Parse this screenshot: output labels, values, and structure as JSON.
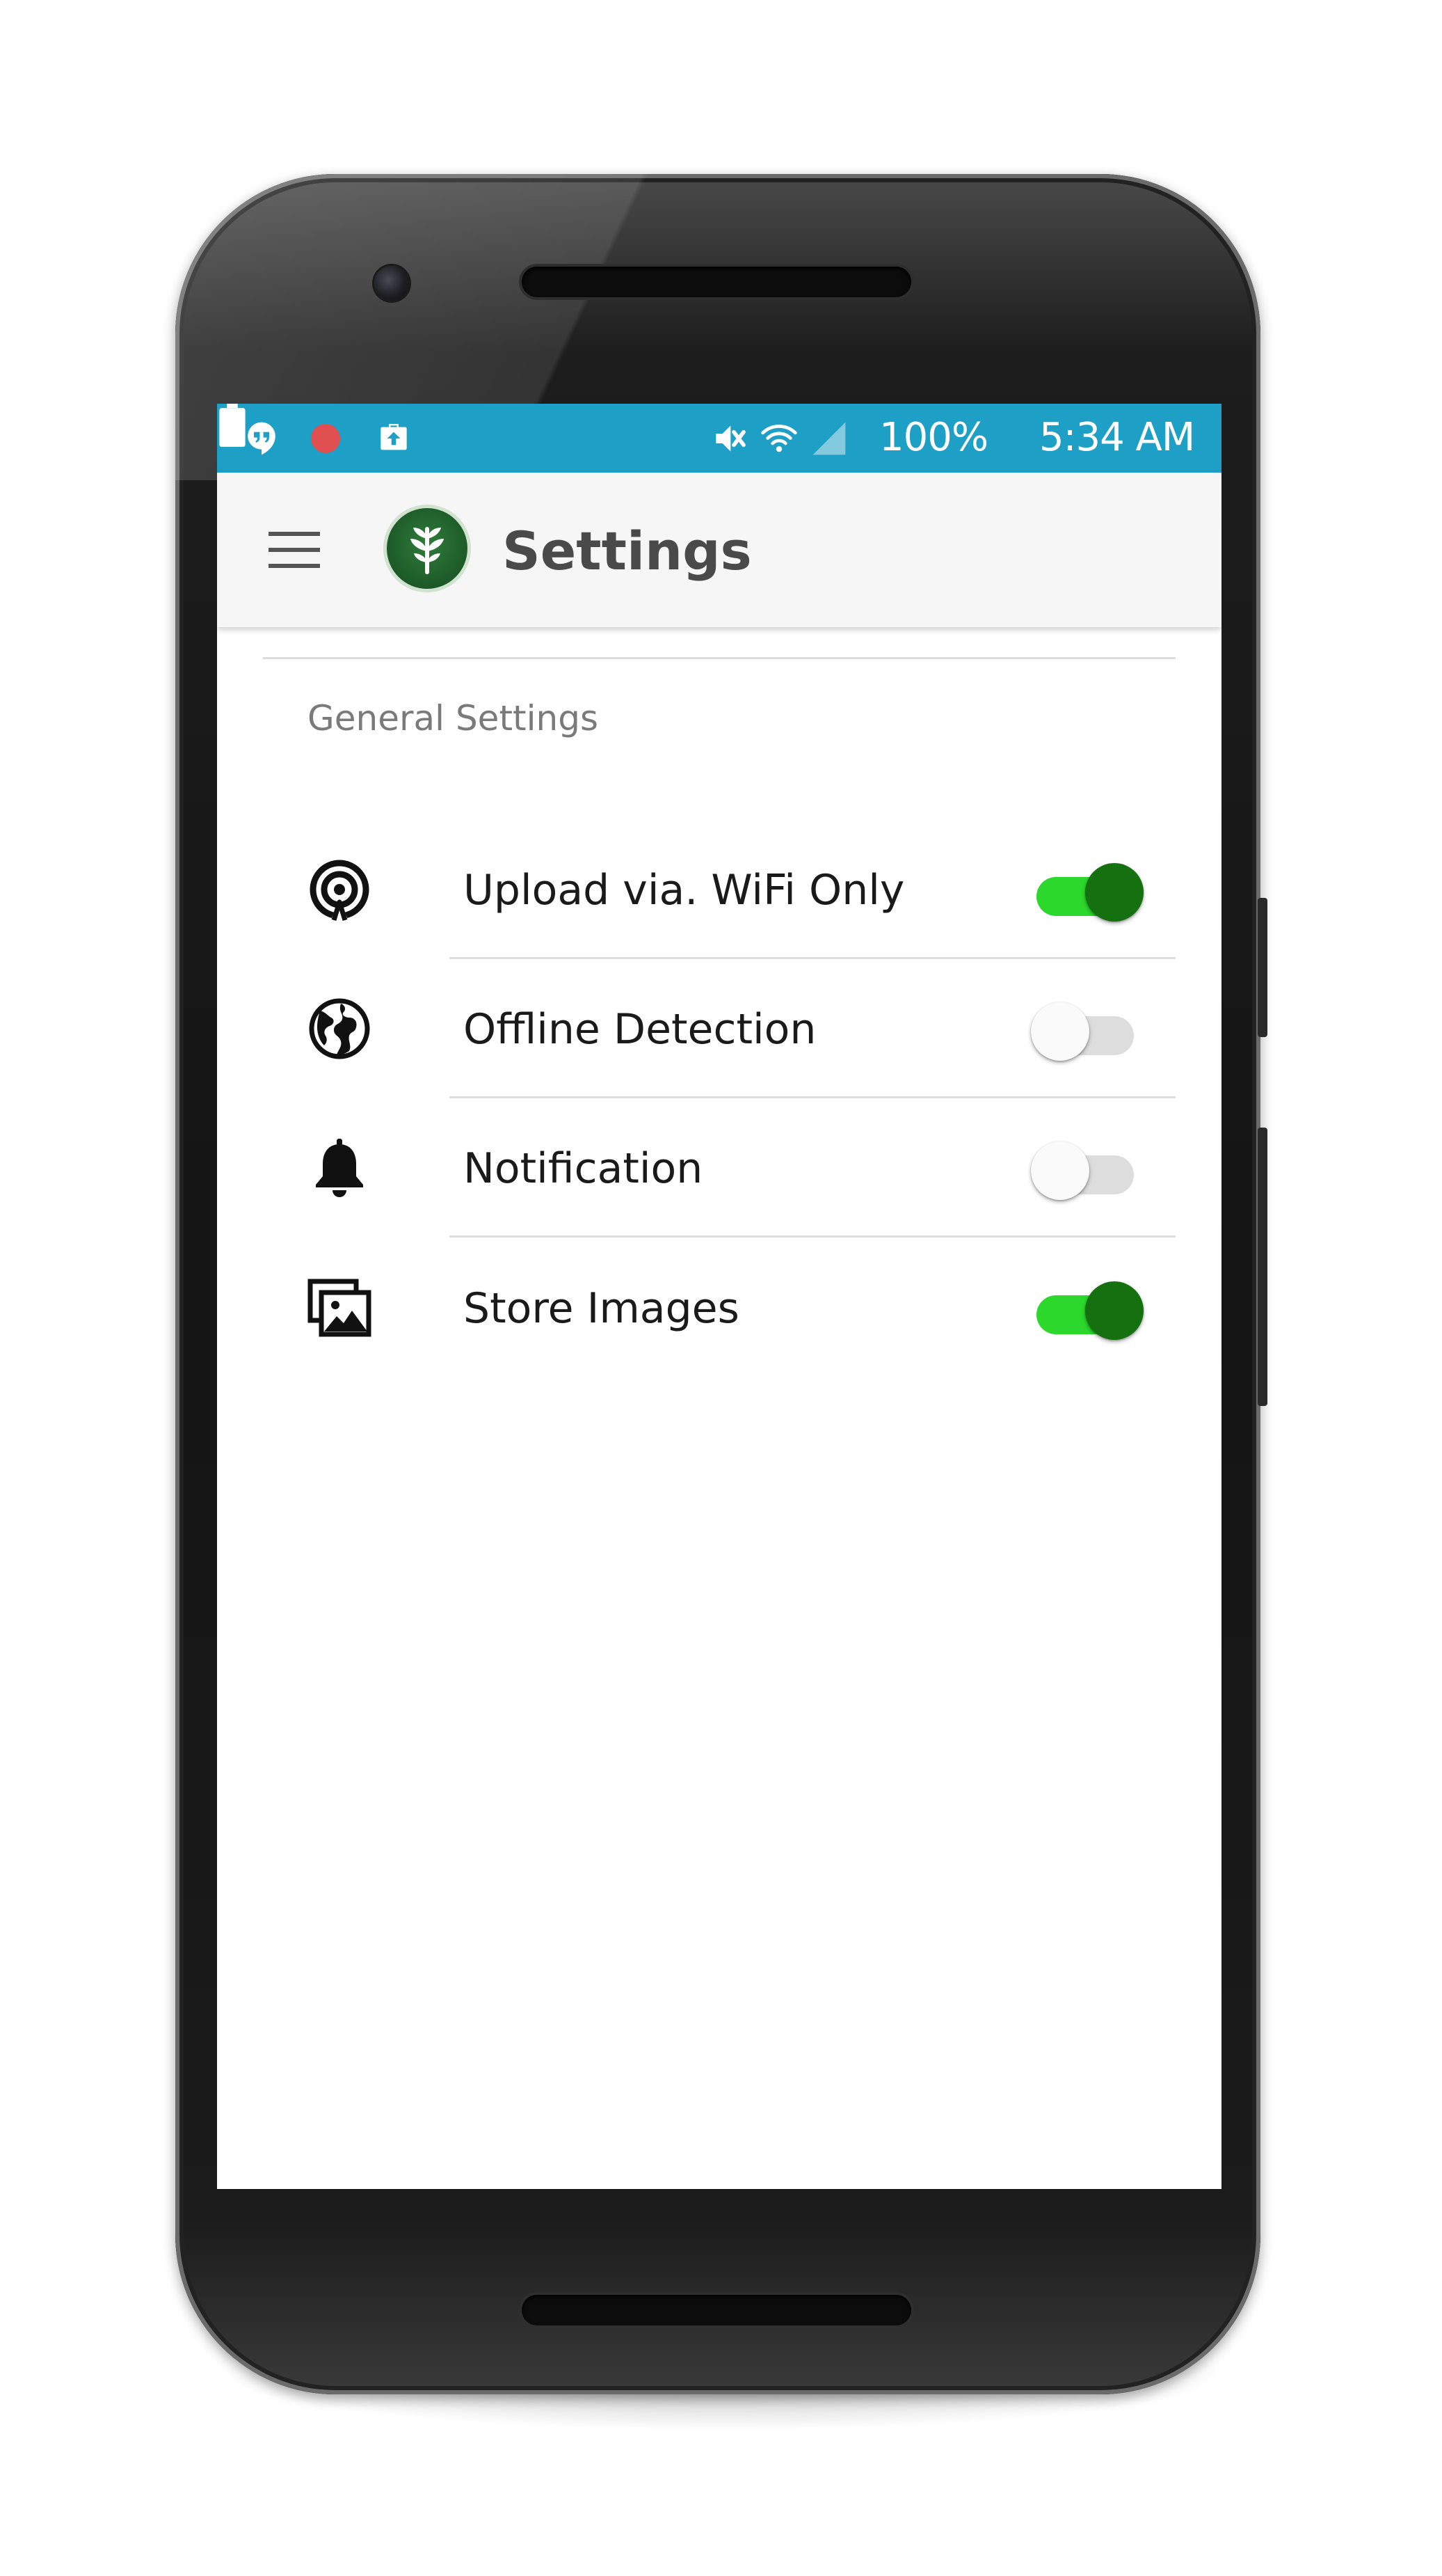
{
  "status_bar": {
    "battery_percent": "100%",
    "time": "5:34 AM",
    "background_color": "#1e9fc5",
    "icons": [
      "hangouts-icon",
      "record-icon",
      "upload-icon",
      "mute-icon",
      "wifi-icon",
      "signal-icon",
      "battery-icon"
    ]
  },
  "app_bar": {
    "title": "Settings",
    "menu_icon": "hamburger-menu-icon",
    "logo_icon": "sprout-logo-icon"
  },
  "settings": {
    "section_title": "General Settings",
    "items": [
      {
        "label": "Upload via. WiFi Only",
        "icon": "broadcast-icon",
        "enabled": true
      },
      {
        "label": "Offline Detection",
        "icon": "globe-icon",
        "enabled": false
      },
      {
        "label": "Notification",
        "icon": "bell-icon",
        "enabled": false
      },
      {
        "label": "Store Images",
        "icon": "images-icon",
        "enabled": true
      }
    ]
  },
  "colors": {
    "toggle_on_track": "#2bd82b",
    "toggle_on_thumb": "#15700f",
    "toggle_off_track": "#dddddd",
    "toggle_off_thumb": "#fafafa",
    "logo_green": "#1f5e2a"
  }
}
